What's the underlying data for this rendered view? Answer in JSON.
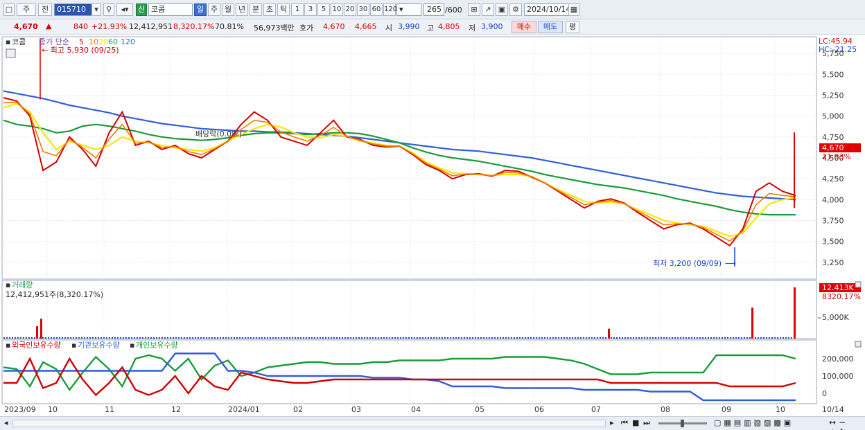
{
  "toolbar": {
    "code_type": "주",
    "range": "전",
    "code": "015710",
    "tag": "신",
    "name": "코콤",
    "periods": [
      "일",
      "주",
      "월",
      "년",
      "분",
      "초",
      "틱"
    ],
    "minute_steps": [
      "1",
      "3",
      "5",
      "10",
      "20",
      "30",
      "60",
      "120"
    ],
    "count": "265",
    "count_total": "/600",
    "date": "2024/10/14"
  },
  "quote": {
    "price": "4,670",
    "change": "840",
    "change_pct": "+21.93%",
    "volume": "12,412,951",
    "volume_pct": "8,320.17%",
    "ratio": "70.81%",
    "amount": "56,973백만",
    "bid_label": "호가",
    "ask": "4,670",
    "bid": "4,665",
    "open_label": "시",
    "open": "3,990",
    "high_label": "고",
    "high": "4,805",
    "low_label": "저",
    "low": "3,900",
    "buy": "매수",
    "sell": "매도",
    "eval": "평"
  },
  "price_panel": {
    "legend_name": "코콤",
    "legend_ma_label": "종가 단순",
    "ma_periods": [
      "5",
      "10",
      "20",
      "60",
      "120"
    ],
    "ma_colors": [
      "#d40000",
      "#f07b00",
      "#f4e800",
      "#1a9b3a",
      "#2f5fd8"
    ],
    "high_note": "← 최고 5,930 (09/25)",
    "low_note": "최저 3,200 (09/09)",
    "dividend_note": "배당락(0.0%)",
    "lc": "LC:45.94",
    "hc": "HC:-21.25",
    "last_price": "4,670",
    "last_pct": "21.93%"
  },
  "volume_panel": {
    "title": "거래량",
    "value": "12,412,951주(8,320.17%)",
    "last": "12.413K",
    "last_pct": "8320.17%",
    "ytick": "5,000K"
  },
  "holdings_panel": {
    "series": [
      {
        "name": "외국인보유수량",
        "color": "#d40000"
      },
      {
        "name": "기관보유수량",
        "color": "#2f5fd8"
      },
      {
        "name": "개인보유수량",
        "color": "#1a9b3a"
      }
    ],
    "yticks": [
      "200,000",
      "100,000",
      "0"
    ]
  },
  "x_axis": [
    "2023/09",
    "10",
    "11",
    "12",
    "2024/01",
    "02",
    "03",
    "04",
    "05",
    "06",
    "07",
    "08",
    "09",
    "10"
  ],
  "x_axis_right": "10/14",
  "chart_data": {
    "type": "line",
    "title": "코콤",
    "x_range": [
      "2023/09",
      "2024/10/14"
    ],
    "price_ticks": [
      5750,
      5500,
      5250,
      5000,
      4750,
      4500,
      4250,
      4000,
      3750,
      3500,
      3250
    ],
    "price_ylim": [
      3050,
      5950
    ],
    "ma_lines": {
      "ma5": [
        5220,
        5180,
        5000,
        4350,
        4450,
        4750,
        4600,
        4400,
        4800,
        5050,
        4650,
        4700,
        4600,
        4650,
        4550,
        4500,
        4600,
        4700,
        4900,
        5050,
        4950,
        4750,
        4700,
        4650,
        4800,
        4950,
        4750,
        4720,
        4650,
        4630,
        4640,
        4540,
        4420,
        4350,
        4250,
        4300,
        4310,
        4280,
        4350,
        4340,
        4270,
        4200,
        4100,
        4000,
        3900,
        3980,
        4010,
        3960,
        3850,
        3750,
        3650,
        3700,
        3720,
        3650,
        3550,
        3450,
        3650,
        4100,
        4200,
        4100,
        4050
      ],
      "ma20": [
        5100,
        5150,
        5050,
        4800,
        4600,
        4700,
        4650,
        4600,
        4650,
        4750,
        4700,
        4680,
        4650,
        4620,
        4600,
        4580,
        4620,
        4700,
        4780,
        4850,
        4900,
        4870,
        4800,
        4750,
        4740,
        4780,
        4760,
        4700,
        4680,
        4650,
        4640,
        4560,
        4450,
        4380,
        4320,
        4310,
        4300,
        4290,
        4300,
        4300,
        4280,
        4200,
        4120,
        4050,
        3980,
        3960,
        3970,
        3950,
        3880,
        3820,
        3750,
        3720,
        3700,
        3680,
        3620,
        3560,
        3600,
        3780,
        3950,
        4000,
        4020
      ],
      "ma60": [
        4950,
        4900,
        4880,
        4850,
        4800,
        4820,
        4880,
        4900,
        4880,
        4850,
        4820,
        4780,
        4750,
        4730,
        4720,
        4710,
        4720,
        4740,
        4770,
        4790,
        4800,
        4800,
        4790,
        4780,
        4790,
        4800,
        4800,
        4790,
        4760,
        4720,
        4680,
        4620,
        4570,
        4530,
        4500,
        4480,
        4460,
        4430,
        4400,
        4370,
        4340,
        4300,
        4270,
        4240,
        4210,
        4180,
        4160,
        4140,
        4110,
        4080,
        4050,
        4010,
        3980,
        3950,
        3920,
        3880,
        3850,
        3830,
        3820,
        3820,
        3820
      ],
      "ma120": [
        5300,
        5270,
        5240,
        5210,
        5170,
        5130,
        5100,
        5070,
        5040,
        5000,
        4970,
        4940,
        4910,
        4890,
        4870,
        4850,
        4840,
        4830,
        4820,
        4820,
        4810,
        4810,
        4800,
        4790,
        4780,
        4770,
        4760,
        4740,
        4720,
        4700,
        4680,
        4660,
        4640,
        4620,
        4600,
        4590,
        4580,
        4560,
        4540,
        4520,
        4500,
        4470,
        4440,
        4410,
        4380,
        4350,
        4320,
        4290,
        4260,
        4230,
        4200,
        4170,
        4140,
        4110,
        4080,
        4060,
        4040,
        4030,
        4020,
        4010,
        4000
      ]
    },
    "volume_spikes_k": {
      "2023/09": 3000,
      "2023/10": 4800,
      "2024/07": 2400,
      "2024/09": 7500,
      "2024/10/14": 12413
    },
    "holdings": {
      "foreign": [
        60000,
        60000,
        200000,
        30000,
        60000,
        200000,
        80000,
        -10000,
        60000,
        150000,
        20000,
        -10000,
        20000,
        100000,
        0,
        100000,
        40000,
        20000,
        120000,
        100000,
        80000,
        70000,
        60000,
        60000,
        70000,
        80000,
        80000,
        80000,
        80000,
        80000,
        80000,
        80000,
        80000,
        80000,
        80000,
        80000,
        80000,
        80000,
        80000,
        80000,
        80000,
        80000,
        80000,
        80000,
        80000,
        80000,
        60000,
        60000,
        60000,
        60000,
        60000,
        60000,
        60000,
        60000,
        60000,
        40000,
        40000,
        40000,
        40000,
        40000,
        60000
      ],
      "institution": [
        130000,
        130000,
        130000,
        130000,
        130000,
        130000,
        130000,
        130000,
        130000,
        130000,
        130000,
        130000,
        130000,
        230000,
        230000,
        230000,
        230000,
        130000,
        130000,
        120000,
        100000,
        100000,
        100000,
        100000,
        100000,
        100000,
        100000,
        100000,
        90000,
        90000,
        90000,
        80000,
        80000,
        70000,
        40000,
        40000,
        40000,
        40000,
        30000,
        30000,
        30000,
        30000,
        30000,
        30000,
        20000,
        20000,
        20000,
        20000,
        20000,
        10000,
        10000,
        10000,
        10000,
        -40000,
        -40000,
        -40000,
        -40000,
        -40000,
        -40000,
        -40000,
        -40000
      ],
      "individual": [
        150000,
        140000,
        40000,
        180000,
        140000,
        20000,
        120000,
        210000,
        140000,
        40000,
        200000,
        220000,
        200000,
        130000,
        200000,
        80000,
        160000,
        190000,
        100000,
        120000,
        150000,
        160000,
        170000,
        180000,
        180000,
        170000,
        170000,
        170000,
        180000,
        180000,
        190000,
        190000,
        190000,
        190000,
        200000,
        200000,
        200000,
        200000,
        210000,
        210000,
        210000,
        210000,
        200000,
        190000,
        170000,
        140000,
        110000,
        110000,
        110000,
        120000,
        120000,
        120000,
        120000,
        120000,
        220000,
        220000,
        220000,
        220000,
        220000,
        220000,
        200000
      ]
    },
    "holdings_ylim": [
      -60000,
      260000
    ]
  }
}
